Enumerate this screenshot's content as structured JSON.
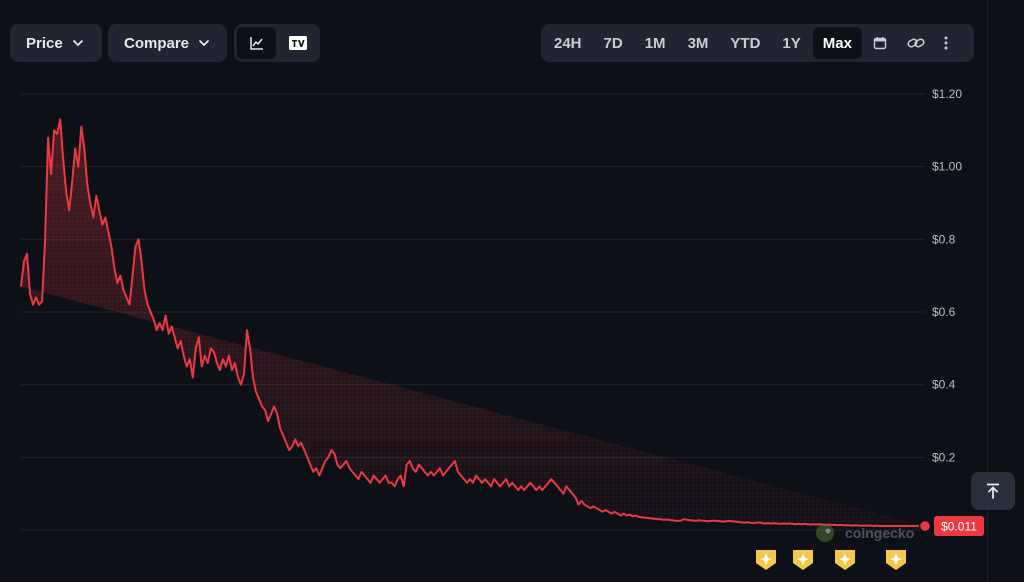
{
  "toolbar": {
    "price_label": "Price",
    "compare_label": "Compare",
    "view_icons": [
      "line-chart-icon",
      "tradingview-icon"
    ],
    "ranges": [
      "24H",
      "7D",
      "1M",
      "3M",
      "YTD",
      "1Y",
      "Max"
    ],
    "active_range": "Max",
    "extra_icons": [
      "calendar-icon",
      "link-icon",
      "more-vertical-icon"
    ]
  },
  "chart_data": {
    "type": "area",
    "title": "",
    "xlabel": "",
    "ylabel": "",
    "ylim": [
      0,
      1.2
    ],
    "yticks": [
      {
        "value": 1.2,
        "label": "$1.20"
      },
      {
        "value": 1.0,
        "label": "$1.00"
      },
      {
        "value": 0.8,
        "label": "$0.8"
      },
      {
        "value": 0.6,
        "label": "$0.6"
      },
      {
        "value": 0.4,
        "label": "$0.4"
      },
      {
        "value": 0.2,
        "label": "$0.2"
      }
    ],
    "grid": true,
    "x": [
      0,
      1,
      2,
      3,
      4,
      5,
      6,
      7,
      8,
      9,
      10,
      11,
      12,
      13,
      14,
      15,
      16,
      17,
      18,
      19,
      20,
      21,
      22,
      23,
      24,
      25,
      26,
      27,
      28,
      29,
      30,
      31,
      32,
      33,
      34,
      35,
      36,
      37,
      38,
      39,
      40,
      41,
      42,
      43,
      44,
      45,
      46,
      47,
      48,
      49,
      50,
      51,
      52,
      53,
      54,
      55,
      56,
      57,
      58,
      59,
      60,
      61,
      62,
      63,
      64,
      65,
      66,
      67,
      68,
      69,
      70,
      71,
      72,
      73,
      74,
      75,
      76,
      77,
      78,
      79,
      80,
      81,
      82,
      83,
      84,
      85,
      86,
      87,
      88,
      89,
      90,
      91,
      92,
      93,
      94,
      95,
      96,
      97,
      98,
      99,
      100,
      101,
      102,
      103,
      104,
      105,
      106,
      107,
      108,
      109,
      110,
      111,
      112,
      113,
      114,
      115,
      116,
      117,
      118,
      119,
      120,
      121,
      122,
      123,
      124,
      125,
      126,
      127,
      128,
      129,
      130,
      131,
      132,
      133,
      134,
      135,
      136,
      137,
      138,
      139,
      140,
      141,
      142,
      143,
      144,
      145,
      146,
      147,
      148,
      149,
      150,
      151,
      152,
      153,
      154,
      155,
      156,
      157,
      158,
      159,
      160,
      161,
      162,
      163,
      164,
      165,
      166,
      167,
      168,
      169,
      170,
      171,
      172,
      173,
      174,
      175,
      176,
      177,
      178,
      179,
      180,
      181,
      182,
      183,
      184,
      185,
      186,
      187,
      188,
      189,
      190,
      191,
      192,
      193,
      194,
      195,
      196,
      197,
      198,
      199,
      200,
      201,
      202,
      203,
      204,
      205,
      206,
      207,
      208,
      209,
      210,
      211,
      212,
      213,
      214,
      215,
      216,
      217,
      218,
      219,
      220,
      221,
      222,
      223,
      224,
      225,
      226,
      227,
      228,
      229,
      230,
      231,
      232,
      233,
      234,
      235,
      236,
      237,
      238,
      239,
      240,
      241,
      242,
      243,
      244,
      245,
      246,
      247,
      248,
      249,
      250,
      251,
      252,
      253,
      254,
      255,
      256,
      257,
      258,
      259,
      260,
      261,
      262,
      263,
      264,
      265,
      266,
      267,
      268,
      269,
      270,
      271,
      272,
      273,
      274,
      275,
      276,
      277,
      278,
      279,
      280,
      281,
      282,
      283,
      284,
      285,
      286,
      287,
      288,
      289,
      290,
      291,
      292,
      293,
      294,
      295,
      296,
      297,
      298,
      299,
      300
    ],
    "series": [
      {
        "color": "#ea3943",
        "values": [
          0.67,
          0.74,
          0.76,
          0.65,
          0.62,
          0.64,
          0.62,
          0.63,
          0.8,
          1.08,
          0.98,
          1.1,
          1.09,
          1.13,
          1.02,
          0.93,
          0.88,
          0.96,
          1.05,
          1.0,
          1.11,
          1.05,
          0.95,
          0.9,
          0.86,
          0.92,
          0.88,
          0.84,
          0.86,
          0.82,
          0.78,
          0.72,
          0.68,
          0.7,
          0.66,
          0.64,
          0.62,
          0.7,
          0.78,
          0.8,
          0.74,
          0.66,
          0.62,
          0.6,
          0.58,
          0.55,
          0.57,
          0.55,
          0.59,
          0.54,
          0.56,
          0.53,
          0.5,
          0.52,
          0.48,
          0.45,
          0.47,
          0.42,
          0.5,
          0.53,
          0.45,
          0.48,
          0.46,
          0.5,
          0.49,
          0.46,
          0.44,
          0.47,
          0.45,
          0.48,
          0.44,
          0.46,
          0.42,
          0.4,
          0.43,
          0.55,
          0.5,
          0.42,
          0.38,
          0.36,
          0.34,
          0.33,
          0.3,
          0.32,
          0.34,
          0.32,
          0.28,
          0.26,
          0.24,
          0.22,
          0.23,
          0.25,
          0.23,
          0.24,
          0.22,
          0.2,
          0.18,
          0.16,
          0.17,
          0.15,
          0.17,
          0.19,
          0.2,
          0.22,
          0.21,
          0.18,
          0.17,
          0.18,
          0.19,
          0.17,
          0.16,
          0.15,
          0.14,
          0.16,
          0.15,
          0.14,
          0.13,
          0.15,
          0.14,
          0.13,
          0.14,
          0.15,
          0.13,
          0.13,
          0.12,
          0.14,
          0.15,
          0.12,
          0.18,
          0.19,
          0.17,
          0.16,
          0.18,
          0.17,
          0.16,
          0.15,
          0.16,
          0.15,
          0.16,
          0.17,
          0.15,
          0.16,
          0.17,
          0.18,
          0.19,
          0.16,
          0.15,
          0.14,
          0.13,
          0.14,
          0.13,
          0.15,
          0.14,
          0.13,
          0.14,
          0.13,
          0.12,
          0.14,
          0.13,
          0.12,
          0.13,
          0.14,
          0.12,
          0.13,
          0.12,
          0.11,
          0.12,
          0.11,
          0.12,
          0.13,
          0.12,
          0.11,
          0.12,
          0.11,
          0.12,
          0.13,
          0.14,
          0.13,
          0.12,
          0.11,
          0.1,
          0.12,
          0.11,
          0.1,
          0.09,
          0.07,
          0.08,
          0.07,
          0.065,
          0.06,
          0.065,
          0.06,
          0.055,
          0.05,
          0.055,
          0.05,
          0.045,
          0.05,
          0.045,
          0.04,
          0.045,
          0.04,
          0.042,
          0.038,
          0.04,
          0.036,
          0.035,
          0.034,
          0.033,
          0.032,
          0.031,
          0.03,
          0.03,
          0.028,
          0.029,
          0.028,
          0.027,
          0.026,
          0.025,
          0.026,
          0.03,
          0.028,
          0.027,
          0.026,
          0.025,
          0.027,
          0.026,
          0.025,
          0.024,
          0.025,
          0.026,
          0.025,
          0.024,
          0.023,
          0.024,
          0.025,
          0.024,
          0.023,
          0.022,
          0.021,
          0.02,
          0.021,
          0.02,
          0.019,
          0.02,
          0.021,
          0.019,
          0.018,
          0.019,
          0.018,
          0.019,
          0.018,
          0.017,
          0.018,
          0.017,
          0.018,
          0.017,
          0.016,
          0.017,
          0.016,
          0.017,
          0.016,
          0.015,
          0.016,
          0.015,
          0.016,
          0.015,
          0.014,
          0.015,
          0.014,
          0.014,
          0.013,
          0.014,
          0.013,
          0.013,
          0.013,
          0.012,
          0.013,
          0.012,
          0.012,
          0.012,
          0.012,
          0.012,
          0.011,
          0.012,
          0.011,
          0.011,
          0.011,
          0.011,
          0.011,
          0.011,
          0.011,
          0.011,
          0.011,
          0.011,
          0.011,
          0.011,
          0.011,
          0.011,
          0.011,
          0.011,
          0.011,
          0.011,
          0.011,
          0.011,
          0.011,
          0.011,
          0.011,
          0.011,
          0.011
        ]
      }
    ],
    "current_price_label": "$0.011",
    "watermark": "coingecko",
    "event_marker_count": 4
  },
  "colors": {
    "background": "#0d1117",
    "line": "#ea3943",
    "badge": "#ea3943",
    "event_marker": "#f5c84c",
    "button_bg": "#20252f"
  }
}
